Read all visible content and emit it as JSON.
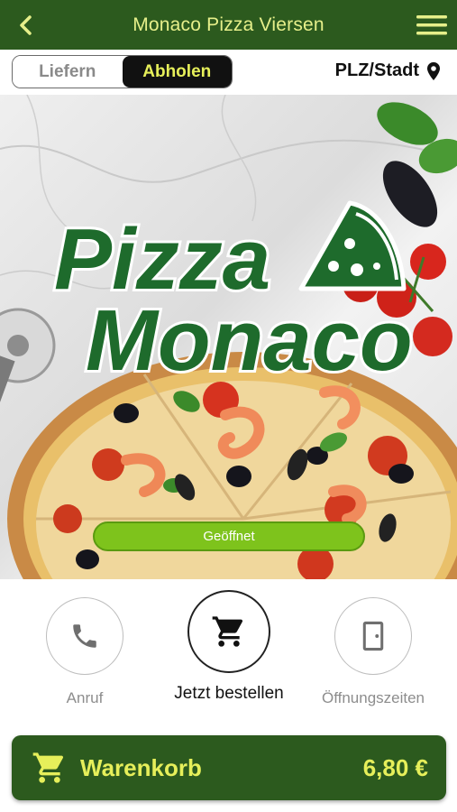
{
  "header": {
    "title": "Monaco Pizza Viersen",
    "back_icon": "chevron-left-icon",
    "menu_icon": "hamburger-menu-icon"
  },
  "mode_toggle": {
    "options": [
      "Liefern",
      "Abholen"
    ],
    "selected": "Abholen"
  },
  "location": {
    "label": "PLZ/Stadt",
    "icon": "map-pin-icon"
  },
  "hero": {
    "logo_line1": "Pizza",
    "logo_line2": "Monaco",
    "status": "Geöffnet"
  },
  "actions": [
    {
      "label": "Anruf",
      "icon": "phone-icon"
    },
    {
      "label": "Jetzt bestellen",
      "icon": "shopping-cart-icon"
    },
    {
      "label": "Öffnungszeiten",
      "icon": "door-icon"
    }
  ],
  "cart": {
    "label": "Warenkorb",
    "total": "6,80 €",
    "icon": "shopping-cart-icon"
  },
  "colors": {
    "brand_green": "#2c5a1e",
    "accent_yellow": "#e6ef5a",
    "logo_green": "#1e6b2c",
    "status_green": "#7ec31c"
  }
}
